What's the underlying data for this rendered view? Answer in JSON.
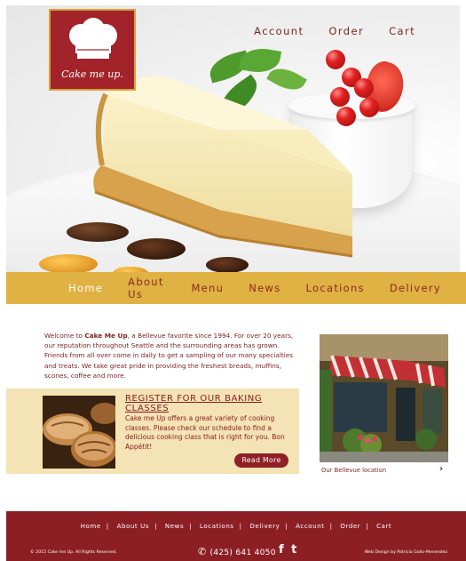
{
  "brand": {
    "logo_text": "Cake me up."
  },
  "top_nav": {
    "account": "Account",
    "order": "Order",
    "cart": "Cart"
  },
  "main_nav": {
    "items": [
      "Home",
      "About Us",
      "Menu",
      "News",
      "Locations",
      "Delivery"
    ],
    "active": "Home"
  },
  "intro": {
    "prefix": "Welcome to ",
    "name": "Cake Me Up",
    "body": ", a Bellevue favorite since 1994. For over 20 years, our reputation throughout Seattle and the surrounding areas has grown. Friends from all over come in daily to get a sampling of our many specialties and treats. We take great pride in providing the freshest breads, muffins, scones, coffee and more."
  },
  "promo": {
    "title": "REGISTER FOR OUR BAKING CLASSES",
    "text": "Cake me Up offers a great variety of cooking classes. Please check our schedule to find a delicious cooking class that is right for you. Bon Appétit!",
    "button": "Read More"
  },
  "location": {
    "caption": "Our Bellevue location",
    "arrow": "›"
  },
  "footer": {
    "nav": [
      "Home",
      "About Us",
      "News",
      "Locations",
      "Delivery",
      "Account",
      "Order",
      "Cart"
    ],
    "copyright": "© 2015 Cake me Up. All Rights Reserved.",
    "phone": "(425) 641 4050",
    "social": "f t",
    "credit": "Web Design by Patricia Gallo-Menendez"
  },
  "colors": {
    "brand_red": "#8c1f24",
    "gold": "#e0b143",
    "cream": "#f4e3b4"
  },
  "icons": {
    "phone": "phone-icon",
    "facebook": "facebook-icon",
    "twitter": "twitter-icon",
    "chef_hat": "chef-hat-icon",
    "next": "chevron-right-icon"
  }
}
